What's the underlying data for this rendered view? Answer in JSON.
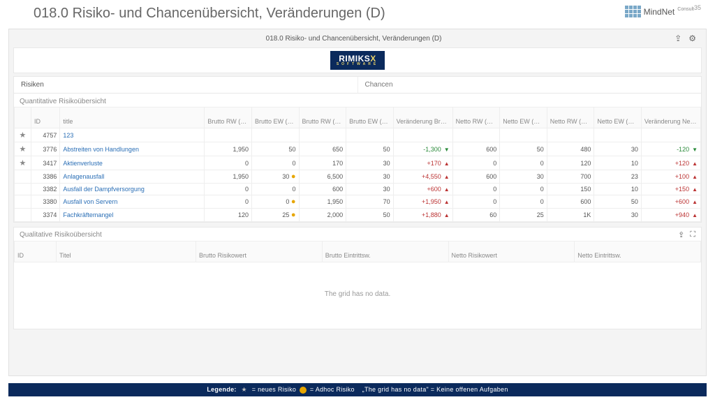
{
  "slide": {
    "title": "018.0 Risiko- und Chancenübersicht, Veränderungen (D)",
    "page": "35",
    "brand": "MindNet",
    "brand_sub": "Consult"
  },
  "app": {
    "title": "018.0 Risiko- und Chancenübersicht, Veränderungen (D)",
    "tabs": {
      "risiken": "Risiken",
      "chancen": "Chancen"
    },
    "quant_title": "Quantitative Risikoübersicht",
    "qual_title": "Qualitative Risikoübersicht",
    "empty": "The grid has no data.",
    "headers": {
      "id": "ID",
      "title": "title",
      "brw_vj": "Brutto RW (T€) Vj.",
      "bew_vj": "Brutto EW (%) Vj.",
      "brw_aj": "Brutto RW (T€) akt. Jahr",
      "bew_aj": "Brutto EW (%) akt. Jahr",
      "d_brw": "Veränderung Brutto RW (T€)",
      "nrw_vj": "Netto RW (T€) Vj.",
      "new_vj": "Netto EW (%) Vj.",
      "nrw_aj": "Netto RW (T€) akt. Jahr",
      "new_aj": "Netto EW (%) akt. Jahr",
      "d_nrw": "Veränderung Netto RW (T€)"
    },
    "qual_headers": {
      "id": "ID",
      "titel": "Titel",
      "br": "Brutto Risikowert",
      "be": "Brutto Eintrittsw.",
      "nr": "Netto Risikowert",
      "ne": "Netto Eintrittsw."
    },
    "rows": [
      {
        "star": true,
        "id": "4757",
        "title": "123",
        "brw_vj": "",
        "bew_vj": "",
        "brw_aj": "",
        "bew_aj": "",
        "d_brw": "",
        "d_brw_dir": "",
        "nrw_vj": "",
        "new_vj": "",
        "nrw_aj": "",
        "new_aj": "",
        "d_nrw": "",
        "d_nrw_dir": "",
        "warn": false
      },
      {
        "star": true,
        "id": "3776",
        "title": "Abstreiten von Handlungen",
        "brw_vj": "1,950",
        "bew_vj": "50",
        "brw_aj": "650",
        "bew_aj": "50",
        "d_brw": "-1,300",
        "d_brw_dir": "down",
        "nrw_vj": "600",
        "new_vj": "50",
        "nrw_aj": "480",
        "new_aj": "30",
        "d_nrw": "-120",
        "d_nrw_dir": "down",
        "warn": false
      },
      {
        "star": true,
        "id": "3417",
        "title": "Aktienverluste",
        "brw_vj": "0",
        "bew_vj": "0",
        "brw_aj": "170",
        "bew_aj": "30",
        "d_brw": "+170",
        "d_brw_dir": "up",
        "nrw_vj": "0",
        "new_vj": "0",
        "nrw_aj": "120",
        "new_aj": "10",
        "d_nrw": "+120",
        "d_nrw_dir": "up",
        "warn": false
      },
      {
        "star": false,
        "id": "3386",
        "title": "Anlagenausfall",
        "brw_vj": "1,950",
        "bew_vj": "30",
        "brw_aj": "6,500",
        "bew_aj": "30",
        "d_brw": "+4,550",
        "d_brw_dir": "up",
        "nrw_vj": "600",
        "new_vj": "30",
        "nrw_aj": "700",
        "new_aj": "23",
        "d_nrw": "+100",
        "d_nrw_dir": "up",
        "warn": true
      },
      {
        "star": false,
        "id": "3382",
        "title": "Ausfall der Dampfversorgung",
        "brw_vj": "0",
        "bew_vj": "0",
        "brw_aj": "600",
        "bew_aj": "30",
        "d_brw": "+600",
        "d_brw_dir": "up",
        "nrw_vj": "0",
        "new_vj": "0",
        "nrw_aj": "150",
        "new_aj": "10",
        "d_nrw": "+150",
        "d_nrw_dir": "up",
        "warn": false
      },
      {
        "star": false,
        "id": "3380",
        "title": "Ausfall von Servern",
        "brw_vj": "0",
        "bew_vj": "0",
        "brw_aj": "1,950",
        "bew_aj": "70",
        "d_brw": "+1,950",
        "d_brw_dir": "up",
        "nrw_vj": "0",
        "new_vj": "0",
        "nrw_aj": "600",
        "new_aj": "50",
        "d_nrw": "+600",
        "d_nrw_dir": "up",
        "warn": true
      },
      {
        "star": false,
        "id": "3374",
        "title": "Fachkräftemangel",
        "brw_vj": "120",
        "bew_vj": "25",
        "brw_aj": "2,000",
        "bew_aj": "50",
        "d_brw": "+1,880",
        "d_brw_dir": "up",
        "nrw_vj": "60",
        "new_vj": "25",
        "nrw_aj": "1K",
        "new_aj": "30",
        "d_nrw": "+940",
        "d_nrw_dir": "up",
        "warn": true
      }
    ]
  },
  "legend": {
    "label": "Legende:",
    "neues": "= neues Risiko",
    "adhoc": "= Adhoc Risiko",
    "nodata": "„The grid has no data\" = Keine offenen Aufgaben"
  }
}
